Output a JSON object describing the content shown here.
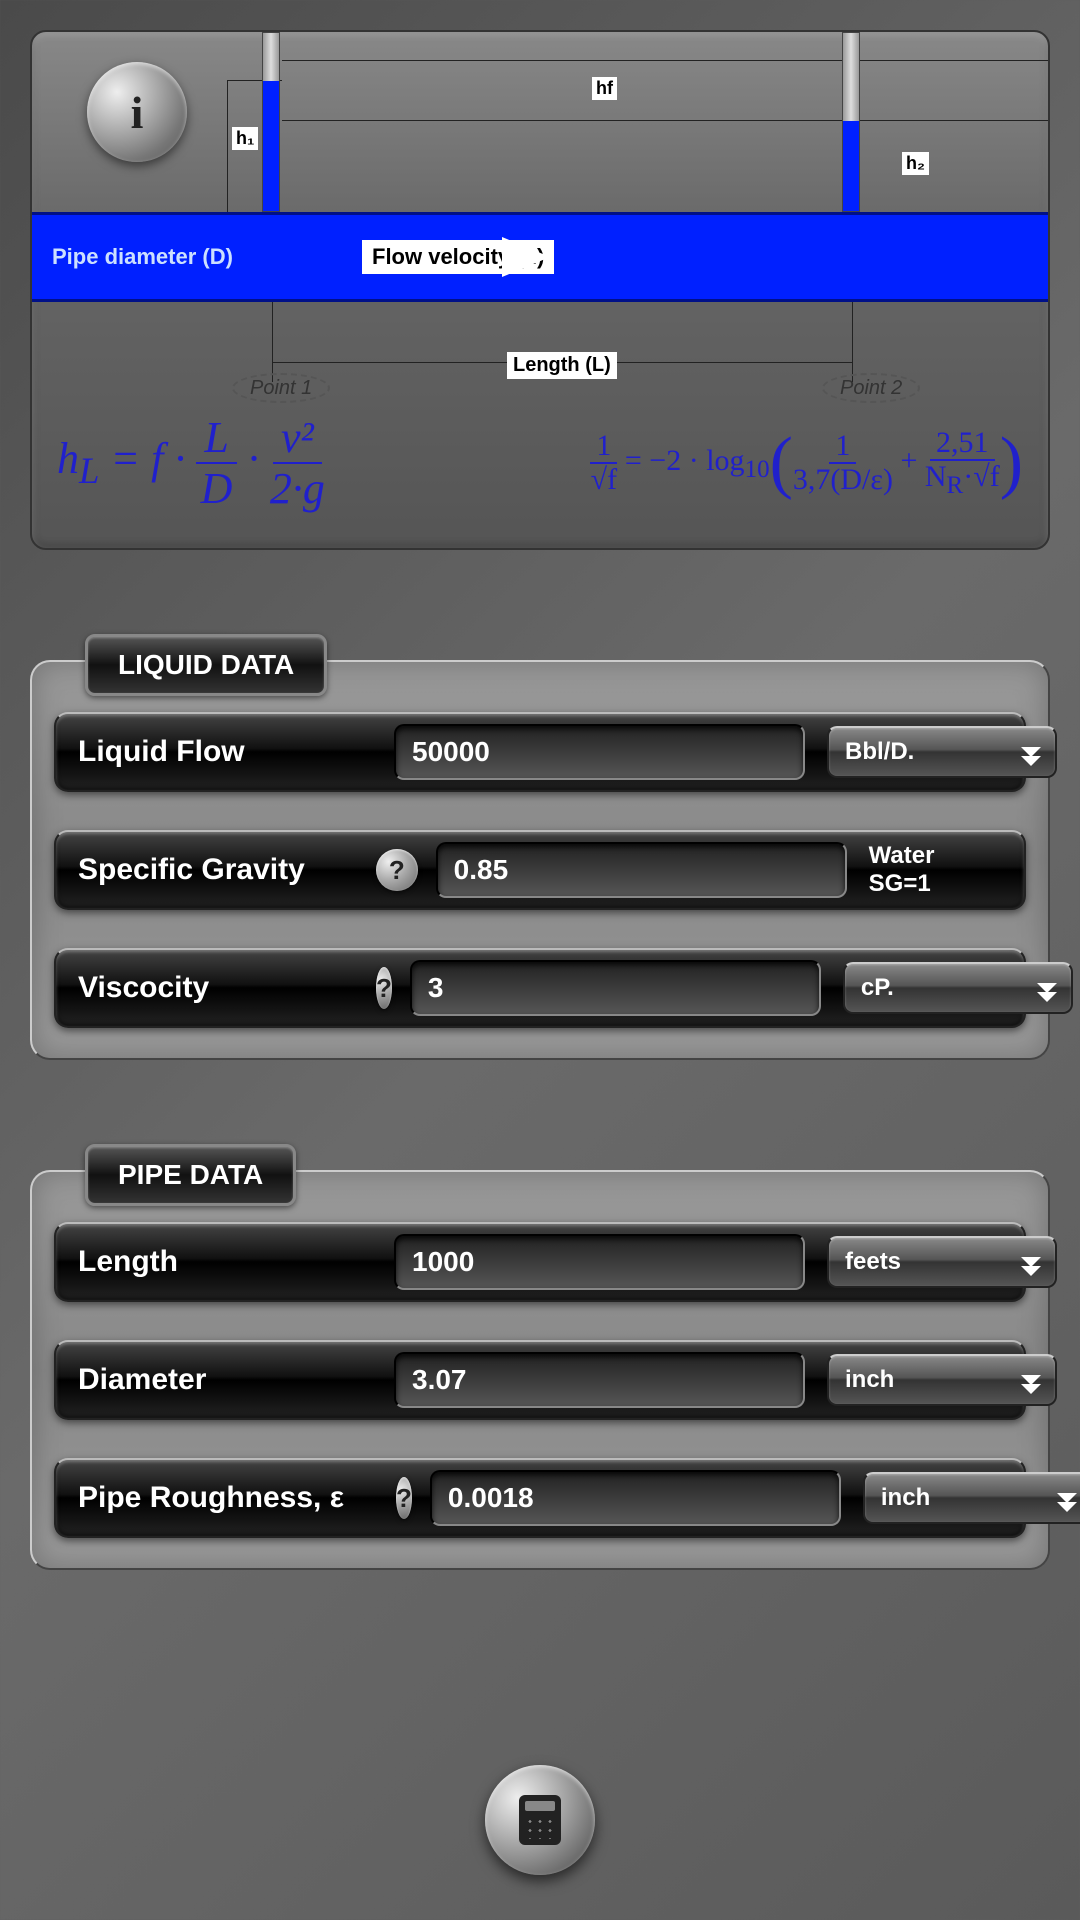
{
  "diagram": {
    "pipe_diameter_label": "Pipe diameter (D)",
    "flow_velocity_label": "Flow velocity (u)",
    "h1": "h₁",
    "h2": "h₂",
    "hf": "hf",
    "length_label": "Length (L)",
    "point1": "Point 1",
    "point2": "Point 2",
    "eq1": "hL = f · (L/D) · (v² / 2·g)",
    "eq2": "1/√f = −2 · log₁₀( 1/(3,7(D/ε)) + 2,51/(NR·√f) )"
  },
  "liquid_section": {
    "title": "LIQUID DATA",
    "flow": {
      "label": "Liquid Flow",
      "value": "50000",
      "unit": "Bbl/D."
    },
    "sg": {
      "label": "Specific Gravity",
      "value": "0.85",
      "note": "Water SG=1"
    },
    "visc": {
      "label": "Viscocity",
      "value": "3",
      "unit": "cP."
    }
  },
  "pipe_section": {
    "title": "PIPE DATA",
    "length": {
      "label": "Length",
      "value": "1000",
      "unit": "feets"
    },
    "diameter": {
      "label": "Diameter",
      "value": "3.07",
      "unit": "inch"
    },
    "roughness": {
      "label": "Pipe Roughness, ε",
      "value": "0.0018",
      "unit": "inch"
    }
  },
  "bottom": {
    "calc": "calculate"
  }
}
